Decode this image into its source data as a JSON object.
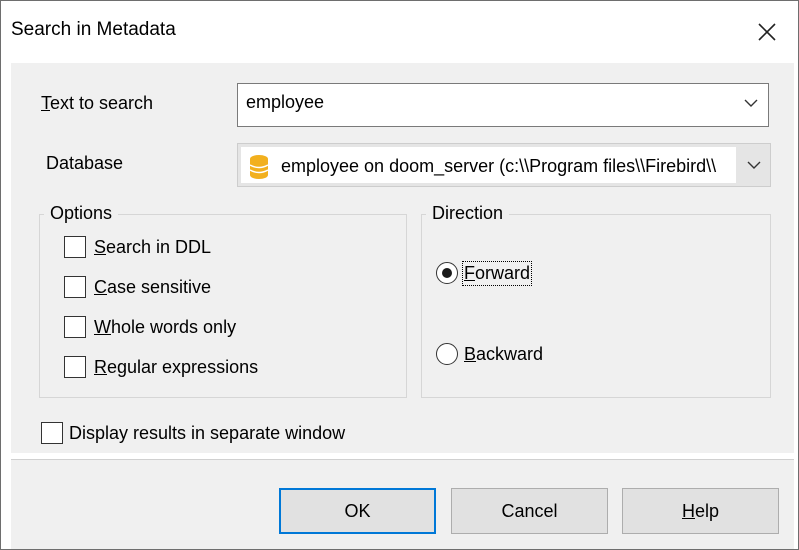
{
  "window": {
    "title": "Search in Metadata"
  },
  "search": {
    "label": "Text to search",
    "value": "employee"
  },
  "database": {
    "label": "Database",
    "value": "employee on doom_server (c:\\\\Program files\\\\Firebird\\\\",
    "icon": "database-icon",
    "icon_color": "#f2b01e"
  },
  "options": {
    "title": "Options",
    "items": [
      {
        "label": "Search in DDL",
        "checked": false
      },
      {
        "label": "Case sensitive",
        "checked": false
      },
      {
        "label": "Whole words only",
        "checked": false
      },
      {
        "label": "Regular expressions",
        "checked": false
      }
    ]
  },
  "direction": {
    "title": "Direction",
    "items": [
      {
        "label": "Forward",
        "selected": true
      },
      {
        "label": "Backward",
        "selected": false
      }
    ]
  },
  "display_separate": {
    "label": "Display results in separate window",
    "checked": false
  },
  "buttons": {
    "ok": "OK",
    "cancel": "Cancel",
    "help": "Help"
  },
  "colors": {
    "accent": "#0078d7",
    "panel": "#f0f0f0"
  }
}
